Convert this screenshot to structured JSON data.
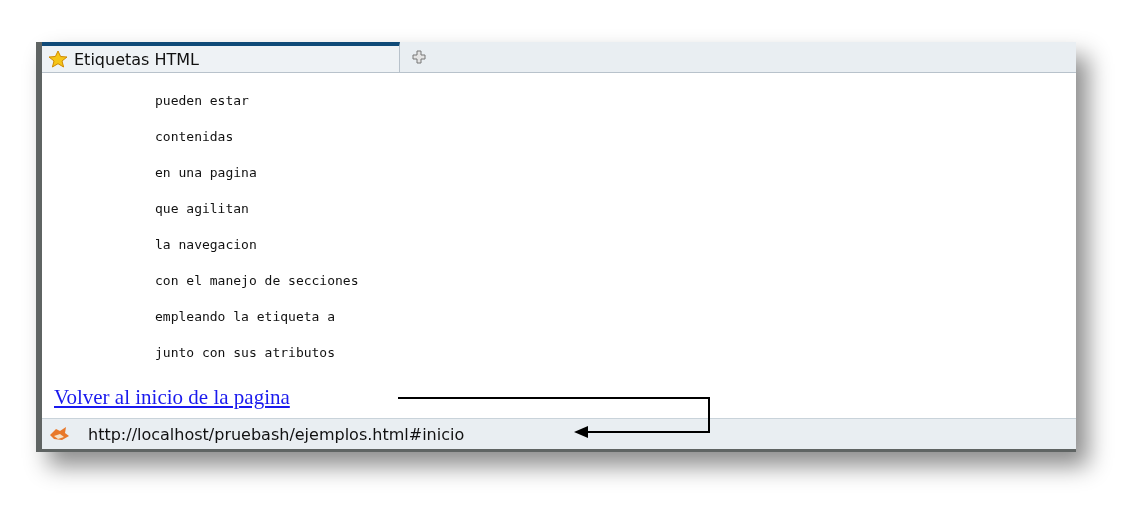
{
  "tabs": [
    {
      "label": "Etiquetas HTML",
      "selected": true
    }
  ],
  "content": {
    "lines": [
      "pueden estar",
      "contenidas",
      "en una pagina",
      "que agilitan",
      "la navegacion",
      "con el manejo de secciones",
      "empleando la etiqueta a",
      "junto con sus atributos"
    ],
    "link": "Volver al inicio de la pagina"
  },
  "status_bar": {
    "url": "http://localhost/pruebash/ejemplos.html#inicio"
  }
}
